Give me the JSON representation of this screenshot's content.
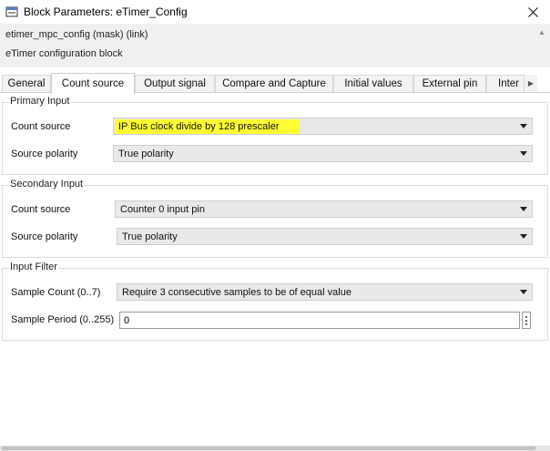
{
  "window": {
    "title": "Block Parameters: eTimer_Config",
    "close_icon": "close-icon",
    "app_icon": "simulink-block-icon"
  },
  "description": {
    "mask_line": "etimer_mpc_config (mask) (link)",
    "block_text": "eTimer configuration block"
  },
  "tabs": [
    {
      "label": "General"
    },
    {
      "label": "Count source",
      "active": true
    },
    {
      "label": "Output signal"
    },
    {
      "label": "Compare and Capture"
    },
    {
      "label": "Initial values"
    },
    {
      "label": "External pin"
    },
    {
      "label": "Inter"
    }
  ],
  "primary_input": {
    "title": "Primary Input",
    "count_source_label": "Count source",
    "count_source_value": "IP Bus clock divide by 128 prescaler",
    "source_polarity_label": "Source polarity",
    "source_polarity_value": "True polarity"
  },
  "secondary_input": {
    "title": "Secondary Input",
    "count_source_label": "Count source",
    "count_source_value": "Counter 0 input pin",
    "source_polarity_label": "Source polarity",
    "source_polarity_value": "True polarity"
  },
  "input_filter": {
    "title": "Input Filter",
    "sample_count_label": "Sample Count (0..7)",
    "sample_count_value": "Require 3 consecutive samples to be of equal value",
    "sample_period_label": "Sample Period (0..255)",
    "sample_period_value": "0"
  },
  "colors": {
    "highlight": "#ffff33",
    "combo_bg": "#e9e9e9",
    "desc_bg": "#f0f0f0"
  }
}
